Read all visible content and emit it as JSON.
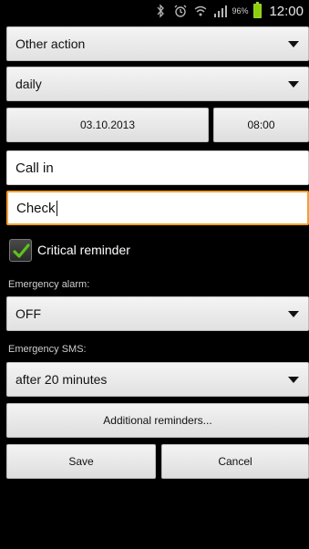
{
  "status_bar": {
    "battery_percent": "96%",
    "time": "12:00",
    "icons": [
      "bluetooth-icon",
      "alarm-icon",
      "wifi-icon",
      "signal-icon",
      "battery-icon"
    ],
    "battery_color": "#8cd10a"
  },
  "form": {
    "action_select": {
      "value": "Other action"
    },
    "frequency_select": {
      "value": "daily"
    },
    "date_button": {
      "label": "03.10.2013"
    },
    "time_button": {
      "label": "08:00"
    },
    "title_field": {
      "value": "Call in"
    },
    "note_field": {
      "value": "Check"
    },
    "critical_checkbox": {
      "label": "Critical reminder",
      "checked": true
    },
    "emergency_alarm": {
      "label": "Emergency alarm:",
      "value": "OFF"
    },
    "emergency_sms": {
      "label": "Emergency SMS:",
      "value": "after 20 minutes"
    },
    "additional_button": {
      "label": "Additional reminders..."
    },
    "save_button": {
      "label": "Save"
    },
    "cancel_button": {
      "label": "Cancel"
    }
  },
  "colors": {
    "focus_border": "#f0a030",
    "checkmark": "#5cc21a"
  }
}
